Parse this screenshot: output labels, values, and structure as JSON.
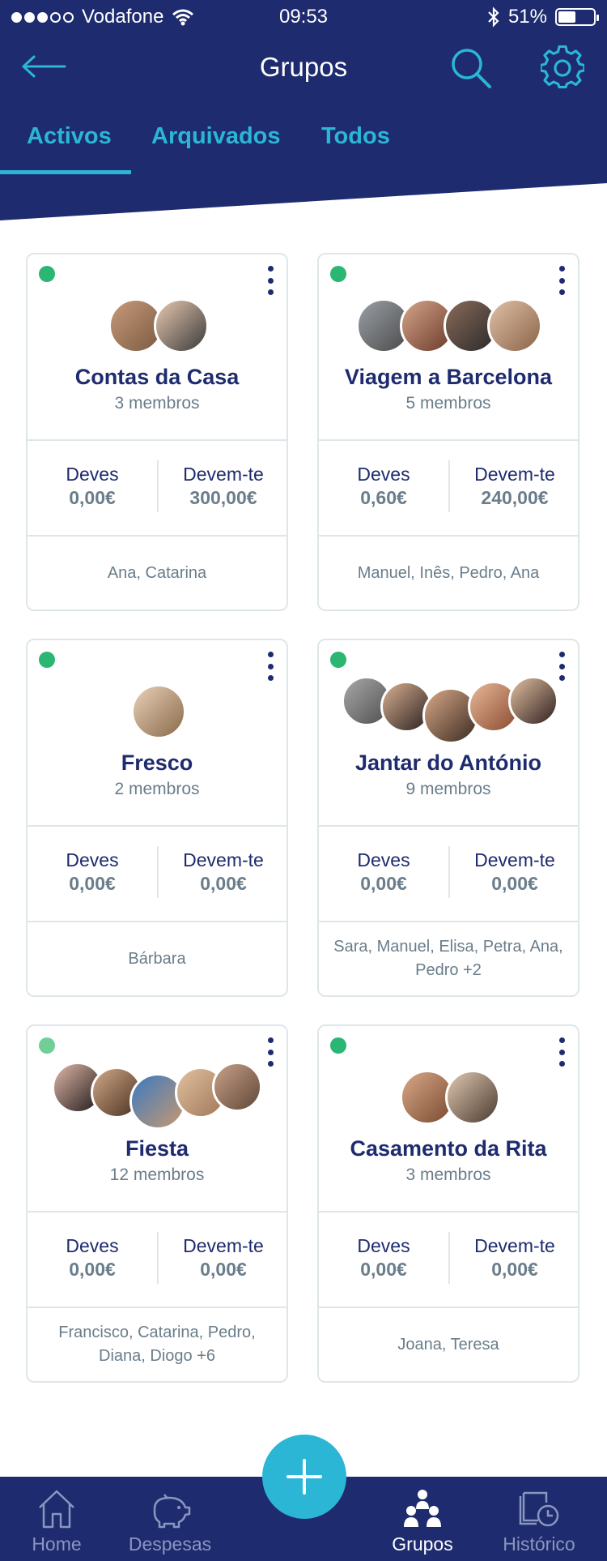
{
  "status_bar": {
    "carrier": "Vodafone",
    "time": "09:53",
    "battery": "51%"
  },
  "nav": {
    "title": "Grupos"
  },
  "tabs": [
    {
      "label": "Activos",
      "active": true
    },
    {
      "label": "Arquivados",
      "active": false
    },
    {
      "label": "Todos",
      "active": false
    }
  ],
  "labels": {
    "owe": "Deves",
    "owed": "Devem-te"
  },
  "groups": [
    {
      "name": "Contas da Casa",
      "members": "3 membros",
      "owe": "0,00€",
      "owed": "300,00€",
      "names": "Ana, Catarina"
    },
    {
      "name": "Viagem a Barcelona",
      "members": "5 membros",
      "owe": "0,60€",
      "owed": "240,00€",
      "names": "Manuel, Inês, Pedro, Ana"
    },
    {
      "name": "Fresco",
      "members": "2 membros",
      "owe": "0,00€",
      "owed": "0,00€",
      "names": "Bárbara"
    },
    {
      "name": "Jantar do António",
      "members": "9 membros",
      "owe": "0,00€",
      "owed": "0,00€",
      "names": "Sara, Manuel, Elisa, Petra, Ana, Pedro +2"
    },
    {
      "name": "Fiesta",
      "members": "12 membros",
      "owe": "0,00€",
      "owed": "0,00€",
      "names": "Francisco, Catarina, Pedro, Diana, Diogo +6"
    },
    {
      "name": "Casamento da Rita",
      "members": "3 membros",
      "owe": "0,00€",
      "owed": "0,00€",
      "names": "Joana, Teresa"
    }
  ],
  "bottom_nav": [
    {
      "label": "Home",
      "icon": "home-icon",
      "active": false
    },
    {
      "label": "Despesas",
      "icon": "piggy-bank-icon",
      "active": false
    },
    {
      "label": "Grupos",
      "icon": "group-icon",
      "active": true
    },
    {
      "label": "Histórico",
      "icon": "history-icon",
      "active": false
    }
  ],
  "colors": {
    "navy": "#1e2b6e",
    "accent": "#2bb6d6",
    "status_green": "#2bb673"
  }
}
